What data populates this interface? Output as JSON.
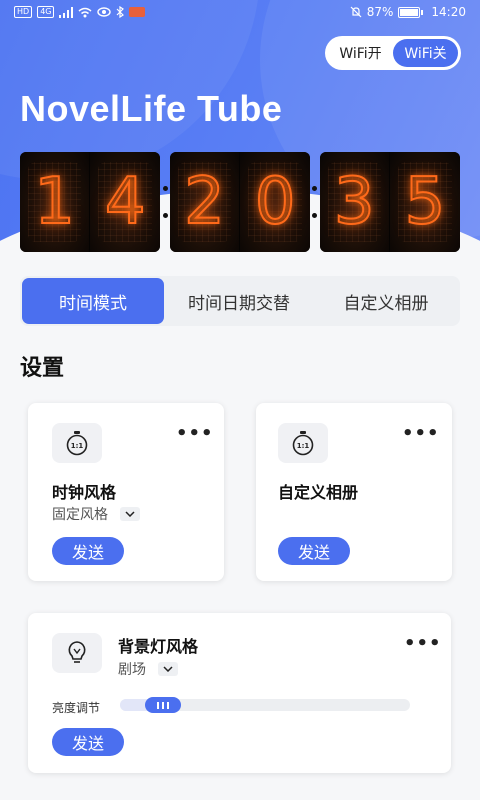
{
  "status_bar": {
    "left_badge_hd": "HD",
    "left_badge_4g": "4G",
    "battery_text": "87%",
    "time": "14:20",
    "battery_level": 0.87
  },
  "wifi_toggle": {
    "on_label": "WiFi开",
    "off_label": "WiFi关",
    "selected": "WiFi关"
  },
  "app_title": "NovelLife Tube",
  "clock_digits": [
    "1",
    "4",
    "2",
    "0",
    "3",
    "5"
  ],
  "tabs": [
    {
      "label": "时间模式",
      "active": true
    },
    {
      "label": "时间日期交替",
      "active": false
    },
    {
      "label": "自定义相册",
      "active": false
    }
  ],
  "settings_title": "设置",
  "cards": {
    "clock_style": {
      "icon": "stopwatch-icon",
      "icon_text": "1:1",
      "title": "时钟风格",
      "option": "固定风格",
      "send_label": "发送"
    },
    "custom_album": {
      "icon": "stopwatch-icon",
      "icon_text": "1:1",
      "title": "自定义相册",
      "send_label": "发送"
    },
    "backlight_style": {
      "icon": "lightbulb-icon",
      "title": "背景灯风格",
      "option": "剧场",
      "brightness_label": "亮度调节",
      "brightness_value": 0.1,
      "send_label": "发送"
    }
  },
  "colors": {
    "accent": "#4b6fef",
    "nixie_glow": "#ff6a1a"
  }
}
